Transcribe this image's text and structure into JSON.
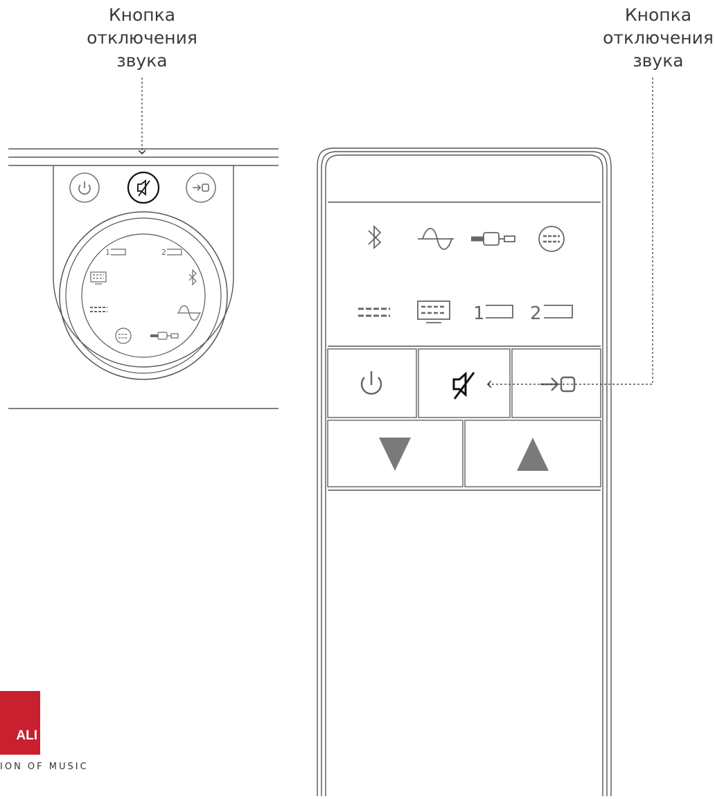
{
  "labels": {
    "left_callout": "Кнопка\nотключения\nзвука",
    "right_callout": "Кнопка\nотключения\nзвука"
  },
  "brand": {
    "logo_text": "ALI",
    "tagline": "ION OF MUSIC",
    "color": "#c8202f"
  },
  "panel": {
    "top_buttons": [
      "power-icon",
      "mute-icon",
      "input-switch-icon"
    ],
    "dial_icons": [
      "input-1-icon",
      "input-2-icon",
      "tv-icon",
      "bluetooth-icon",
      "optical-icon",
      "analog-icon",
      "hdmi-icon",
      "minijack-icon"
    ],
    "highlighted": "mute-icon"
  },
  "remote": {
    "source_row_1": [
      "bluetooth-icon",
      "analog-icon",
      "minijack-icon",
      "hdmi-icon"
    ],
    "source_row_2": [
      "optical-icon",
      "tv-icon",
      "input-1-icon",
      "input-2-icon"
    ],
    "source_row_2_text": {
      "input_1": "1",
      "input_2": "2"
    },
    "control_row": [
      "power-icon",
      "mute-icon",
      "input-switch-icon"
    ],
    "volume_row": [
      "volume-down-icon",
      "volume-up-icon"
    ],
    "highlighted": "mute-icon"
  },
  "colors": {
    "line": "#555555",
    "icon": "#6e6e6e",
    "highlight": "#111111",
    "volume": "#7a7a7a"
  }
}
